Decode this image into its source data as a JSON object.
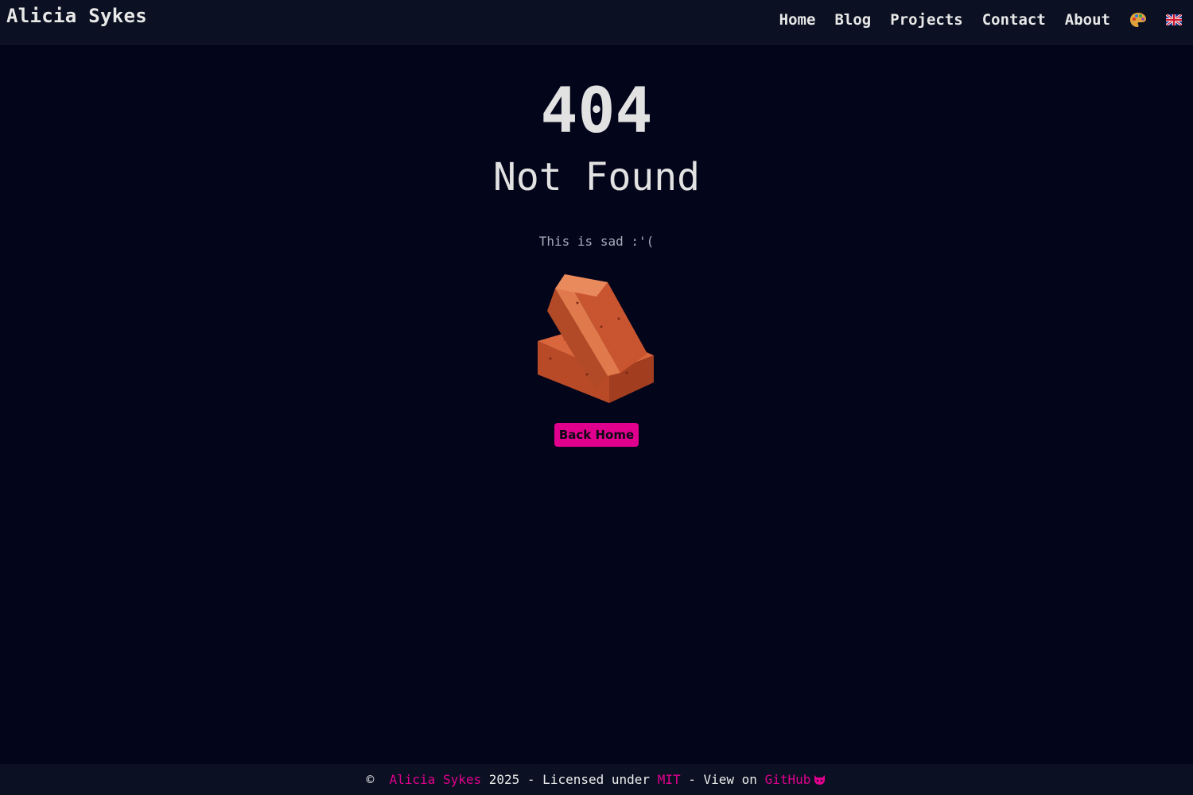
{
  "header": {
    "brand": "Alicia Sykes",
    "nav": [
      {
        "label": "Home"
      },
      {
        "label": "Blog"
      },
      {
        "label": "Projects"
      },
      {
        "label": "Contact"
      },
      {
        "label": "About"
      }
    ],
    "theme_icon": "palette-icon",
    "language_icon": "uk-flag-icon"
  },
  "main": {
    "code": "404",
    "title": "Not Found",
    "subtitle": "This is sad :'(",
    "image_icon": "brick-icon",
    "button_label": "Back Home"
  },
  "footer": {
    "copyright": "©",
    "author": "Alicia Sykes",
    "year_text": "2025 - Licensed under",
    "license": "MIT",
    "view_text": "- View on",
    "github": "GitHub",
    "github_icon": "github-icon"
  },
  "colors": {
    "background": "#03051a",
    "header_bg": "#0b1122",
    "accent": "#e1008e",
    "text": "#e6e6e6",
    "muted": "#a8aab8",
    "brick": "#c4502c"
  }
}
